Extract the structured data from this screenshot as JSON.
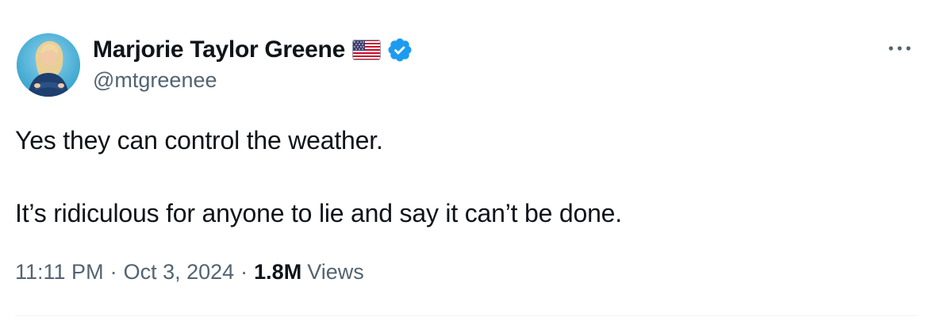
{
  "author": {
    "display_name": "Marjorie Taylor Greene",
    "handle": "@mtgreenee",
    "flag_icon": "us-flag-emoji",
    "verified_icon": "verified-badge-icon",
    "verified_color": "#1d9bf0"
  },
  "tweet": {
    "lines": [
      "Yes they can control the weather.",
      "It’s ridiculous for anyone to lie and say it can’t be done."
    ]
  },
  "meta": {
    "time": "11:11 PM",
    "separator": "·",
    "date": "Oct 3, 2024",
    "views_count": "1.8M",
    "views_label": "Views"
  },
  "more_icon": "more-horizontal-icon",
  "colors": {
    "text_primary": "#0f1419",
    "text_secondary": "#536471",
    "divider": "#eff3f4"
  }
}
